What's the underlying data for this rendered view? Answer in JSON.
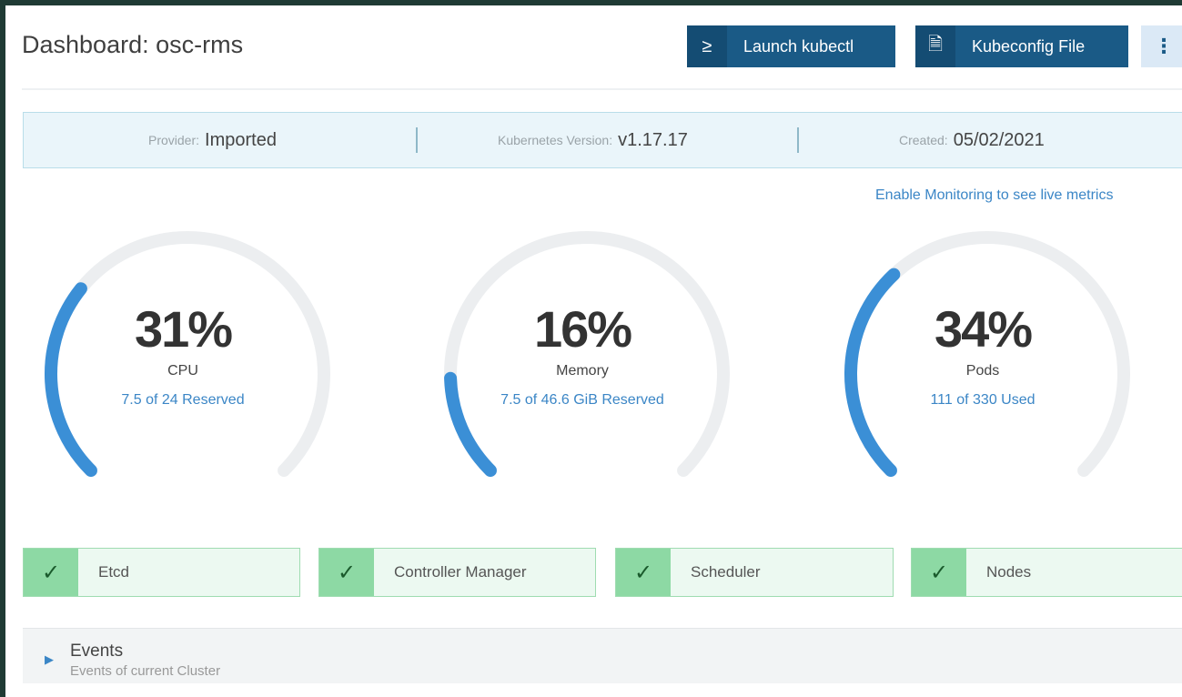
{
  "header": {
    "title": "Dashboard: osc-rms",
    "launch_kubectl": {
      "icon": "≥",
      "label": "Launch kubectl"
    },
    "kubeconfig": {
      "icon": "🗎",
      "label": "Kubeconfig File"
    },
    "more_icon": "⋮"
  },
  "info": {
    "provider_label": "Provider:",
    "provider_value": "Imported",
    "version_label": "Kubernetes Version:",
    "version_value": "v1.17.17",
    "created_label": "Created:",
    "created_value": "05/02/2021"
  },
  "monitoring_link": "Enable Monitoring to see live metrics",
  "gauges": [
    {
      "percent": "31%",
      "label": "CPU",
      "detail": "7.5 of 24 Reserved",
      "value": 0.31
    },
    {
      "percent": "16%",
      "label": "Memory",
      "detail": "7.5 of 46.6 GiB Reserved",
      "value": 0.16
    },
    {
      "percent": "34%",
      "label": "Pods",
      "detail": "111 of 330 Used",
      "value": 0.34
    }
  ],
  "colors": {
    "accent": "#3b8fd6",
    "track": "#eceef0",
    "button": "#1a5a86",
    "healthy": "#8dd9a4"
  },
  "components": [
    {
      "name": "Etcd",
      "status": "healthy"
    },
    {
      "name": "Controller Manager",
      "status": "healthy"
    },
    {
      "name": "Scheduler",
      "status": "healthy"
    },
    {
      "name": "Nodes",
      "status": "healthy"
    }
  ],
  "events": {
    "title": "Events",
    "subtitle": "Events of current Cluster"
  }
}
